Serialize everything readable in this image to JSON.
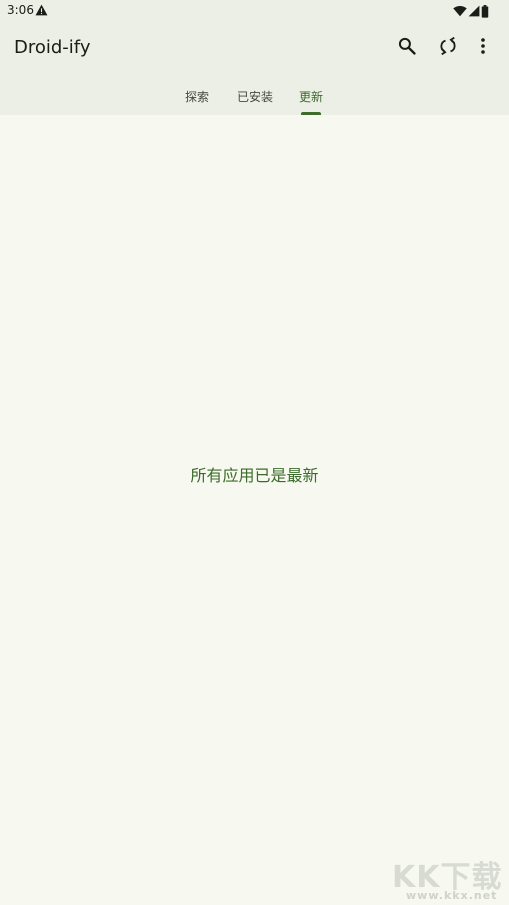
{
  "status_bar": {
    "time": "3:06",
    "alert_icon": "warning-icon",
    "wifi_icon": "wifi-icon",
    "signal_icon": "signal-icon",
    "battery_icon": "battery-icon"
  },
  "app_bar": {
    "title": "Droid-ify",
    "actions": [
      {
        "name": "search",
        "icon": "search-icon"
      },
      {
        "name": "sync",
        "icon": "sync-icon"
      },
      {
        "name": "more",
        "icon": "more-vert-icon"
      }
    ]
  },
  "tabs": [
    {
      "label": "探索",
      "selected": false
    },
    {
      "label": "已安装",
      "selected": false
    },
    {
      "label": "更新",
      "selected": true
    }
  ],
  "content": {
    "empty_message": "所有应用已是最新"
  },
  "watermark": {
    "brand": "KK下载",
    "url": "www.kkx.net"
  },
  "colors": {
    "background": "#f7f9f0",
    "app_bar": "#ebefe5",
    "accent": "#3b6b2a"
  }
}
